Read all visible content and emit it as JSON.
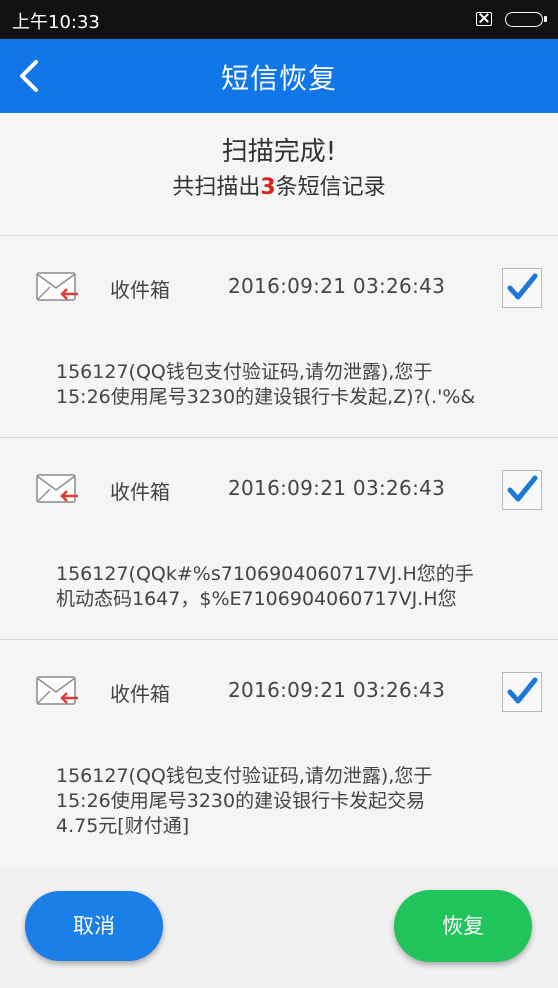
{
  "status_bar": {
    "time": "上午10:33",
    "sim_icon": "no-sim-icon",
    "battery_icon": "battery-icon"
  },
  "nav": {
    "title": "短信恢复",
    "back_icon": "chevron-left-icon"
  },
  "summary": {
    "title": "扫描完成!",
    "count_prefix": "共扫描出",
    "count": "3",
    "count_suffix": "条短信记录"
  },
  "messages": [
    {
      "folder": "收件箱",
      "time": "2016:09:21  03:26:43",
      "checked": true,
      "body_line1": "156127(QQ钱包支付验证码,请勿泄露),您于",
      "body_line2": "15:26使用尾号3230的建设银行卡发起,Z)?(.'%&",
      "body_line3": ""
    },
    {
      "folder": "收件箱",
      "time": "2016:09:21  03:26:43",
      "checked": true,
      "body_line1": "156127(QQk#%s7106904060717VJ.H您的手",
      "body_line2": "机动态码1647，$%E7106904060717VJ.H您",
      "body_line3": ""
    },
    {
      "folder": "收件箱",
      "time": "2016:09:21  03:26:43",
      "checked": true,
      "body_line1": "156127(QQ钱包支付验证码,请勿泄露),您于",
      "body_line2": "15:26使用尾号3230的建设银行卡发起交易",
      "body_line3": "4.75元[财付通]"
    }
  ],
  "buttons": {
    "cancel": "取消",
    "restore": "恢复"
  },
  "colors": {
    "nav_blue": "#1177e9",
    "cancel_blue": "#1a7fe6",
    "restore_green": "#21c45b",
    "count_red": "#d7261e",
    "check_blue": "#1e78d6",
    "mail_red": "#e53935"
  }
}
